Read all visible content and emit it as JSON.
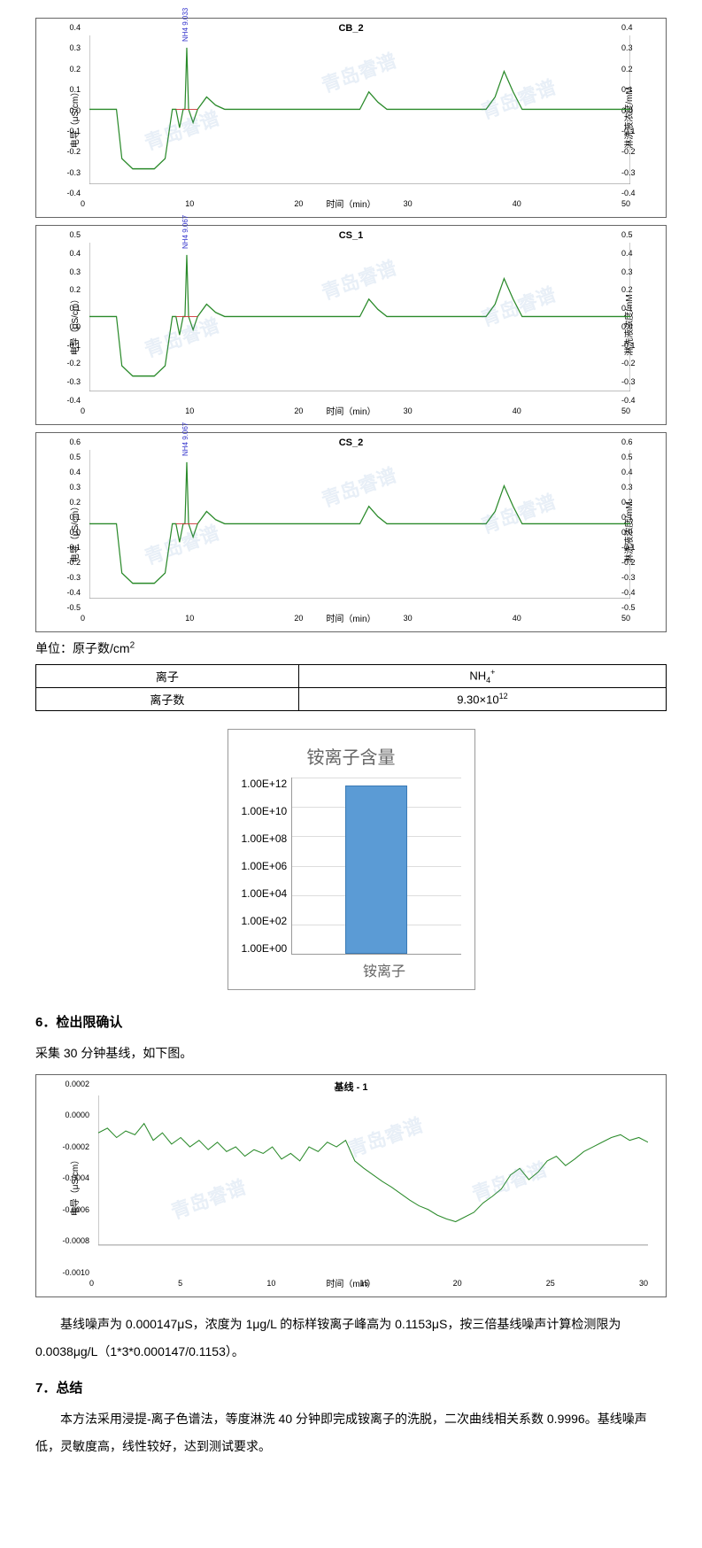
{
  "chroms": [
    {
      "title": "CB_2",
      "yl": "电导（μS/cm）",
      "yr": "淋洗液浓度/mM",
      "xl": "时间（min）",
      "yticks": [
        "0.4",
        "0.3",
        "0.2",
        "0.1",
        "0.0",
        "-0.1",
        "-0.2",
        "-0.3",
        "-0.4"
      ],
      "yticksR": [
        "0.4",
        "0.3",
        "0.2",
        "0.1",
        "0.0",
        "-0.1",
        "-0.2",
        "-0.3",
        "-0.4"
      ],
      "xticks": [
        "0",
        "10",
        "20",
        "30",
        "40",
        "50"
      ],
      "peak": "NH4 9.033"
    },
    {
      "title": "CS_1",
      "yl": "电导（μS/cm）",
      "yr": "淋洗液浓度/mM",
      "xl": "时间（min）",
      "yticks": [
        "0.5",
        "0.4",
        "0.3",
        "0.2",
        "0.1",
        "0.0",
        "-0.1",
        "-0.2",
        "-0.3",
        "-0.4"
      ],
      "yticksR": [
        "0.5",
        "0.4",
        "0.3",
        "0.2",
        "0.1",
        "0.0",
        "-0.1",
        "-0.2",
        "-0.3",
        "-0.4"
      ],
      "xticks": [
        "0",
        "10",
        "20",
        "30",
        "40",
        "50"
      ],
      "peak": "NH4 9.067"
    },
    {
      "title": "CS_2",
      "yl": "电导（μS/cm）",
      "yr": "淋洗液浓度/mM",
      "xl": "时间（min）",
      "yticks": [
        "0.6",
        "0.5",
        "0.4",
        "0.3",
        "0.2",
        "0.1",
        "0.0",
        "-0.1",
        "-0.2",
        "-0.3",
        "-0.4",
        "-0.5"
      ],
      "yticksR": [
        "0.6",
        "0.5",
        "0.4",
        "0.3",
        "0.2",
        "0.1",
        "0.0",
        "-0.1",
        "-0.2",
        "-0.3",
        "-0.4",
        "-0.5"
      ],
      "xticks": [
        "0",
        "10",
        "20",
        "30",
        "40",
        "50"
      ],
      "peak": "NH4 9.067"
    }
  ],
  "unit_label": "单位：原子数/cm",
  "unit_sup": "2",
  "table": {
    "r1c1": "离子",
    "r1c2": "NH",
    "r1c2_sub": "4",
    "r1c2_sup": "+",
    "r2c1": "离子数",
    "r2c2": "9.30×10",
    "r2c2_sup": "12"
  },
  "chart_data": {
    "type": "bar",
    "title": "铵离子含量",
    "categories": [
      "铵离子"
    ],
    "values": [
      9300000000000.0
    ],
    "yticks": [
      "1.00E+12",
      "1.00E+10",
      "1.00E+08",
      "1.00E+06",
      "1.00E+04",
      "1.00E+02",
      "1.00E+00"
    ],
    "ylim": [
      1,
      10000000000000.0
    ],
    "yscale": "log",
    "xlabel": "铵离子"
  },
  "section6": {
    "heading": "6．检出限确认",
    "intro": "采集 30 分钟基线，如下图。",
    "baseline": {
      "title": "基线 - 1",
      "yl": "电导（μS/cm）",
      "xl": "时间（min）",
      "yticks": [
        "0.0002",
        "0.0000",
        "-0.0002",
        "-0.0004",
        "-0.0006",
        "-0.0008",
        "-0.0010"
      ],
      "xticks": [
        "0",
        "5",
        "10",
        "15",
        "20",
        "25",
        "30"
      ]
    },
    "para": "基线噪声为 0.000147μS，浓度为 1μg/L 的标样铵离子峰高为 0.1153μS，按三倍基线噪声计算检测限为 0.0038μg/L（1*3*0.000147/0.1153）。"
  },
  "section7": {
    "heading": "7．总结",
    "para": "本方法采用浸提-离子色谱法，等度淋洗 40 分钟即完成铵离子的洗脱，二次曲线相关系数 0.9996。基线噪声低，灵敏度高，线性较好，达到测试要求。"
  },
  "watermark": "青岛睿谱"
}
